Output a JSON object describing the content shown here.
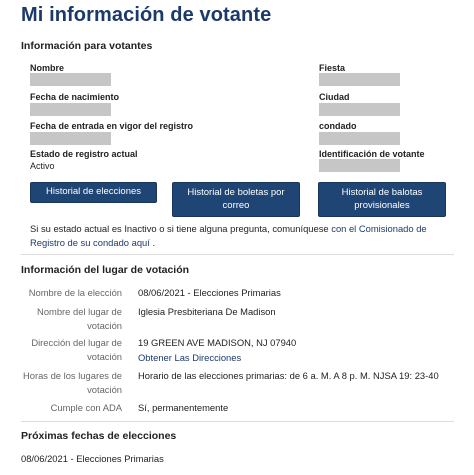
{
  "page": {
    "title": "Mi información de votante"
  },
  "voter_info": {
    "heading": "Información para votantes",
    "left": [
      {
        "label": "Nombre",
        "value": ""
      },
      {
        "label": "Fecha de nacimiento",
        "value": ""
      },
      {
        "label": "Fecha de entrada en vigor del registro",
        "value": ""
      },
      {
        "label": "Estado de registro actual",
        "value": "Activo"
      }
    ],
    "right": [
      {
        "label": "Fiesta",
        "value": ""
      },
      {
        "label": "Ciudad",
        "value": ""
      },
      {
        "label": "condado",
        "value": ""
      },
      {
        "label": "Identificación de votante",
        "value": ""
      }
    ]
  },
  "buttons": {
    "election_history": "Historial de elecciones",
    "mail_ballot_history": "Historial de boletas por correo",
    "provisional_ballot_history": "Historial de balotas provisionales"
  },
  "note": {
    "text": "Si su estado actual es Inactivo o si tiene alguna pregunta, comuníquese ",
    "link": "con el Comisionado de Registro de su condado aquí",
    "suffix": " ."
  },
  "polling_place": {
    "heading": "Información del lugar de votación",
    "rows": [
      {
        "label": "Nombre de la elección",
        "value": "08/06/2021 - Elecciones Primarias"
      },
      {
        "label": "Nombre del lugar de votación",
        "value": "Iglesia Presbiteriana De Madison"
      },
      {
        "label": "Dirección del lugar de votación",
        "value": "19 GREEN AVE MADISON, NJ 07940",
        "link": "Obtener Las Direcciones"
      },
      {
        "label": "Horas de los lugares de votación",
        "value": "Horario de las elecciones primarias: de 6 a. M. A 8 p. M. NJSA 19: 23-40"
      },
      {
        "label": "Cumple con ADA",
        "value": "Sí, permanentemente"
      }
    ]
  },
  "upcoming": {
    "heading": "Próximas fechas de elecciones",
    "items": [
      "08/06/2021 - Elecciones Primarias"
    ]
  }
}
